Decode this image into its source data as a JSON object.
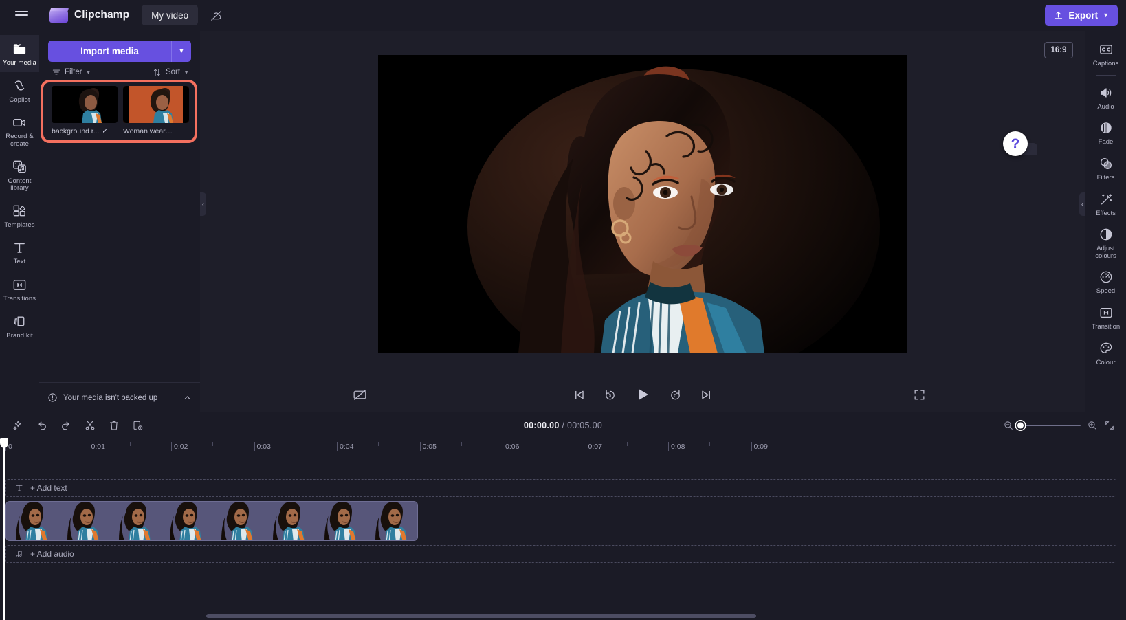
{
  "app": {
    "brand_name": "Clipchamp",
    "project_name": "My video",
    "export_label": "Export",
    "menu_icon": "hamburger-icon",
    "cloud_icon": "cloud-off-icon"
  },
  "left_rail": {
    "items": [
      {
        "label": "Your media",
        "icon": "folder-icon",
        "active": true
      },
      {
        "label": "Copilot",
        "icon": "copilot-icon",
        "active": false
      },
      {
        "label": "Record & create",
        "icon": "video-camera-icon",
        "active": false
      },
      {
        "label": "Content library",
        "icon": "content-library-icon",
        "active": false
      },
      {
        "label": "Templates",
        "icon": "templates-icon",
        "active": false
      },
      {
        "label": "Text",
        "icon": "text-icon",
        "active": false
      },
      {
        "label": "Transitions",
        "icon": "transitions-icon",
        "active": false
      },
      {
        "label": "Brand kit",
        "icon": "brand-kit-icon",
        "active": false
      }
    ]
  },
  "media_panel": {
    "import_label": "Import media",
    "import_caret_icon": "chevron-down-icon",
    "filter_label": "Filter",
    "sort_label": "Sort",
    "filter_icon": "filter-icon",
    "sort_icon": "sort-arrows-icon",
    "highlight_color": "#f4705f",
    "items": [
      {
        "name": "background r...",
        "checked": true,
        "check_icon": "check-icon",
        "thumb": "dark"
      },
      {
        "name": "Woman wearing...",
        "checked": false,
        "thumb": "orange"
      }
    ],
    "backup_notice": "Your media isn't backed up",
    "backup_icon": "info-circle-icon",
    "backup_caret_icon": "chevron-up-icon"
  },
  "stage": {
    "aspect_ratio": "16:9",
    "captions_toggle_icon": "captions-off-icon",
    "skip_back_icon": "skip-to-start-icon",
    "back5_icon": "rewind-5-icon",
    "play_icon": "play-icon",
    "forward5_icon": "forward-5-icon",
    "skip_forward_icon": "skip-to-end-icon",
    "fullscreen_icon": "fullscreen-icon",
    "collapse_left_icon": "chevron-left-icon",
    "collapse_right_icon": "chevron-left-icon",
    "help_label": "?",
    "panel_chevron_icon": "chevron-down-icon"
  },
  "right_rail": {
    "items": [
      {
        "label": "Captions",
        "icon": "cc-icon"
      },
      {
        "label": "Audio",
        "icon": "speaker-icon"
      },
      {
        "label": "Fade",
        "icon": "fade-icon"
      },
      {
        "label": "Filters",
        "icon": "filters-icon"
      },
      {
        "label": "Effects",
        "icon": "effects-wand-icon"
      },
      {
        "label": "Adjust colours",
        "icon": "adjust-colours-icon"
      },
      {
        "label": "Speed",
        "icon": "speedometer-icon"
      },
      {
        "label": "Transition",
        "icon": "transition-icon"
      },
      {
        "label": "Colour",
        "icon": "palette-icon"
      }
    ]
  },
  "timeline": {
    "tools": [
      {
        "name": "magic-wand-icon"
      },
      {
        "name": "undo-icon"
      },
      {
        "name": "redo-icon"
      },
      {
        "name": "split-scissors-icon"
      },
      {
        "name": "delete-trash-icon"
      },
      {
        "name": "duplicate-icon"
      }
    ],
    "current_time": "00:00.00",
    "separator": "/",
    "total_time": "00:05.00",
    "zoom_out_icon": "zoom-out-icon",
    "zoom_in_icon": "zoom-in-icon",
    "fit_icon": "fit-to-screen-icon",
    "zoom_value": 0,
    "ruler_ticks": [
      "0",
      "0:01",
      "0:02",
      "0:03",
      "0:04",
      "0:05",
      "0:06",
      "0:07",
      "0:08",
      "0:09"
    ],
    "text_track_label": "+ Add text",
    "text_track_icon": "text-t-icon",
    "audio_track_label": "+ Add audio",
    "audio_track_icon": "music-note-icon",
    "video_clip_frames": 8
  }
}
